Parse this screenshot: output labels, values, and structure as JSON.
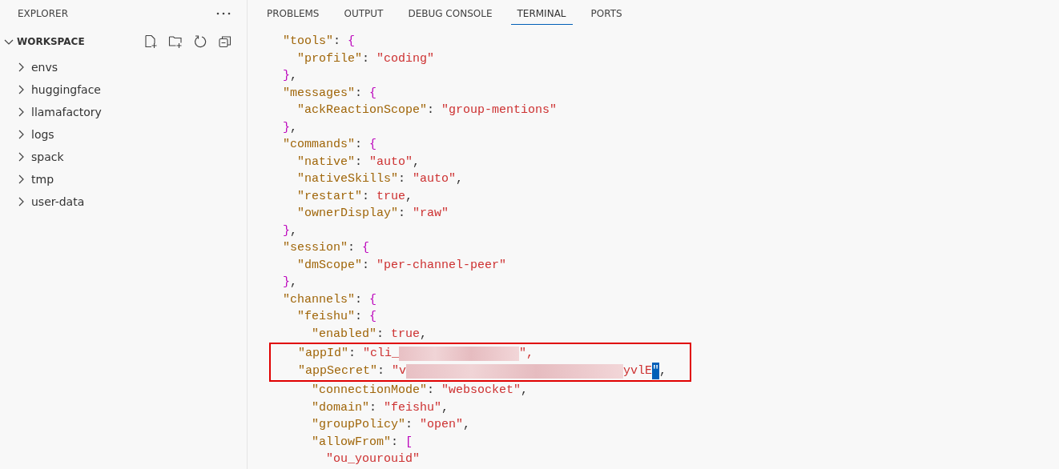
{
  "sidebar": {
    "title": "EXPLORER",
    "section": {
      "label": "WORKSPACE",
      "expanded": true,
      "items": [
        {
          "label": "envs",
          "expanded": false
        },
        {
          "label": "huggingface",
          "expanded": false
        },
        {
          "label": "llamafactory",
          "expanded": false
        },
        {
          "label": "logs",
          "expanded": false
        },
        {
          "label": "spack",
          "expanded": false
        },
        {
          "label": "tmp",
          "expanded": false
        },
        {
          "label": "user-data",
          "expanded": false
        }
      ]
    }
  },
  "panel": {
    "tabs": [
      {
        "label": "PROBLEMS",
        "selected": false
      },
      {
        "label": "OUTPUT",
        "selected": false
      },
      {
        "label": "DEBUG CONSOLE",
        "selected": false
      },
      {
        "label": "TERMINAL",
        "selected": true
      },
      {
        "label": "PORTS",
        "selected": false
      }
    ],
    "terminal": {
      "lines": [
        {
          "text": "\"tools\": {"
        },
        {
          "text": "  \"profile\": \"coding\""
        },
        {
          "text": "},"
        },
        {
          "text": "\"messages\": {"
        },
        {
          "text": "  \"ackReactionScope\": \"group-mentions\""
        },
        {
          "text": "},"
        },
        {
          "text": "\"commands\": {"
        },
        {
          "text": "  \"native\": \"auto\","
        },
        {
          "text": "  \"nativeSkills\": \"auto\","
        },
        {
          "text": "  \"restart\": true,"
        },
        {
          "text": "  \"ownerDisplay\": \"raw\""
        },
        {
          "text": "},"
        },
        {
          "text": "\"session\": {"
        },
        {
          "text": "  \"dmScope\": \"per-channel-peer\""
        },
        {
          "text": "},"
        },
        {
          "text": "\"channels\": {"
        },
        {
          "text": "  \"feishu\": {"
        },
        {
          "text": "    \"enabled\": true,"
        },
        {
          "highlighted": true,
          "segments": [
            {
              "kind": "code",
              "text": "    \"appId\": \"cli_"
            },
            {
              "kind": "redacted"
            },
            {
              "kind": "code",
              "text": "\","
            }
          ]
        },
        {
          "highlighted": true,
          "segments": [
            {
              "kind": "code",
              "text": "    \"appSecret\": \"v"
            },
            {
              "kind": "redacted"
            },
            {
              "kind": "value",
              "text": "yvlE"
            },
            {
              "kind": "cursor",
              "text": "\""
            },
            {
              "kind": "code",
              "text": ","
            }
          ]
        },
        {
          "text": "    \"connectionMode\": \"websocket\","
        },
        {
          "text": "    \"domain\": \"feishu\","
        },
        {
          "text": "    \"groupPolicy\": \"open\","
        },
        {
          "text": "    \"allowFrom\": ["
        },
        {
          "text": "      \"ou_yourouid\""
        }
      ]
    }
  }
}
